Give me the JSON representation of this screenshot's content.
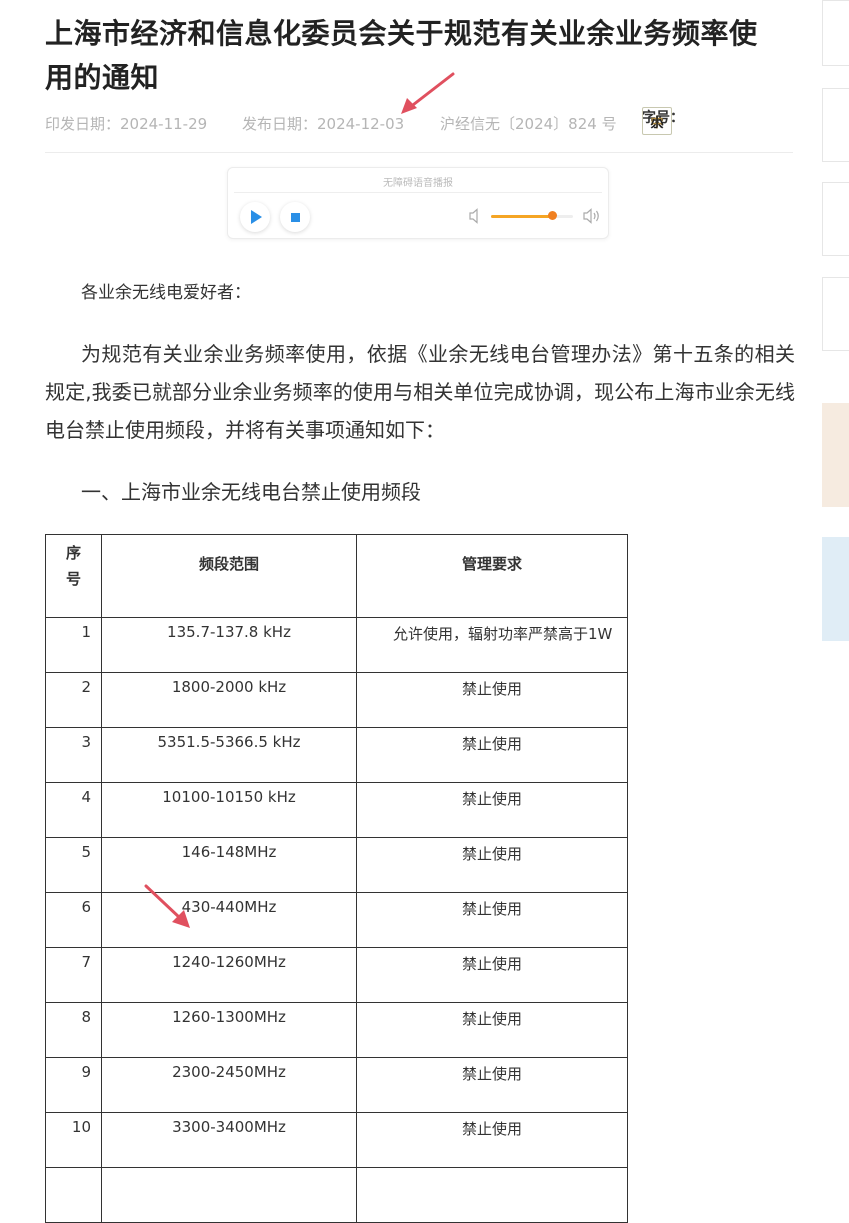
{
  "article": {
    "title": "上海市经济和信息化委员会关于规范有关业余业务频率使用的通知",
    "meta": {
      "issue_date": "印发日期：2024-11-29",
      "publish_date": "发布日期：2024-12-03",
      "doc_number": "沪经信无〔2024〕824 号"
    },
    "font_size": {
      "label": "字号：",
      "options": [
        "大",
        "中",
        "小"
      ],
      "selected": "中"
    },
    "player": {
      "label": "无障碍语音播报",
      "volume_percent": 75,
      "icons": [
        "play-icon",
        "stop-icon",
        "volume-low-icon",
        "volume-high-icon"
      ]
    },
    "salutation": "各业余无线电爱好者：",
    "paragraph": "为规范有关业余业务频率使用，依据《业余无线电台管理办法》第十五条的相关规定,我委已就部分业余业务频率的使用与相关单位完成协调，现公布上海市业余无线电台禁止使用频段，并将有关事项通知如下：",
    "section_heading": "一、上海市业余无线电台禁止使用频段",
    "table": {
      "headers": {
        "no": [
          "序",
          "号"
        ],
        "band": "频段范围",
        "req": "管理要求"
      },
      "rows": [
        {
          "no": "1",
          "band": "135.7-137.8 kHz",
          "req": "允许使用，辐射功率严禁高于1W"
        },
        {
          "no": "2",
          "band": "1800-2000 kHz",
          "req": "禁止使用"
        },
        {
          "no": "3",
          "band": "5351.5-5366.5 kHz",
          "req": "禁止使用"
        },
        {
          "no": "4",
          "band": "10100-10150 kHz",
          "req": "禁止使用"
        },
        {
          "no": "5",
          "band": "146-148MHz",
          "req": "禁止使用"
        },
        {
          "no": "6",
          "band": "430-440MHz",
          "req": "禁止使用"
        },
        {
          "no": "7",
          "band": "1240-1260MHz",
          "req": "禁止使用"
        },
        {
          "no": "8",
          "band": "1260-1300MHz",
          "req": "禁止使用"
        },
        {
          "no": "9",
          "band": "2300-2450MHz",
          "req": "禁止使用"
        },
        {
          "no": "10",
          "band": "3300-3400MHz",
          "req": "禁止使用"
        }
      ]
    }
  },
  "colors": {
    "annotation_arrow": "#e0505f",
    "accent_blue": "#2a8fe6",
    "volume_orange": "#f08020",
    "selected_font_text": "#b08a3e"
  }
}
